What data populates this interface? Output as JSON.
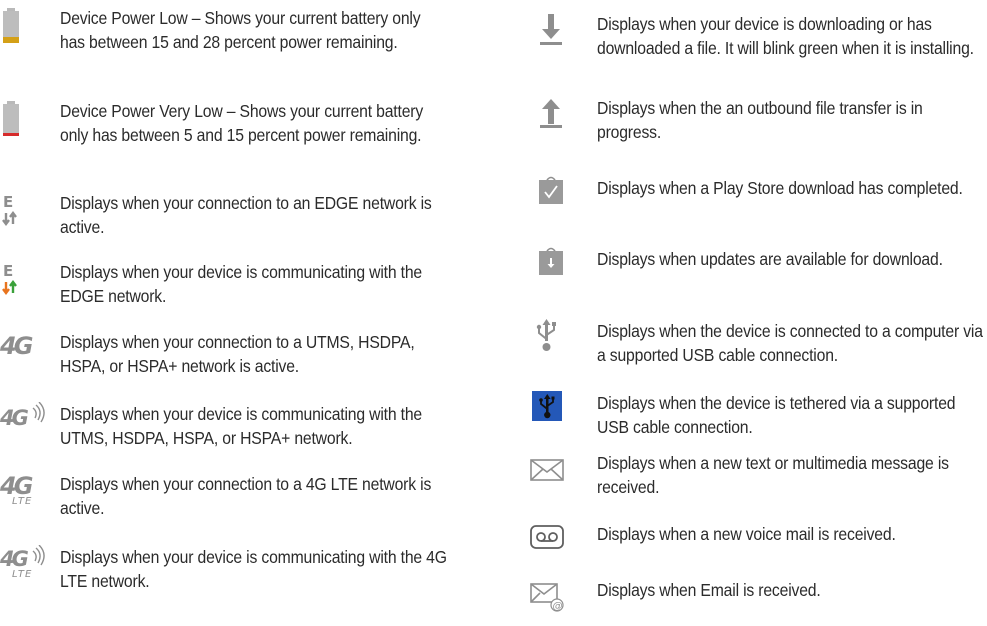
{
  "left_items": [
    {
      "icon": "battery-low-icon",
      "text": "Device Power Low – Shows your current battery only has between 15 and 28 percent power remaining."
    },
    {
      "icon": "battery-very-low-icon",
      "text": "Device Power Very Low – Shows your current battery only has between 5 and 15 percent power remaining."
    },
    {
      "icon": "edge-network-icon",
      "text": "Displays when your connection to an EDGE network is active."
    },
    {
      "icon": "edge-communicating-icon",
      "text": "Displays when your device is communicating with the EDGE network."
    },
    {
      "icon": "4g-network-icon",
      "text": "Displays when your connection to a UTMS, HSDPA, HSPA, or HSPA+ network is active."
    },
    {
      "icon": "4g-communicating-icon",
      "text": "Displays when your device is communicating with the UTMS, HSDPA, HSPA, or HSPA+ network."
    },
    {
      "icon": "4g-lte-network-icon",
      "text": "Displays when your connection to a 4G LTE network is active."
    },
    {
      "icon": "4g-lte-communicating-icon",
      "text": "Displays when your device is communicating with the 4G LTE network."
    }
  ],
  "right_items": [
    {
      "icon": "download-icon",
      "text": "Displays when your device is downloading or has downloaded a file. It will blink green when it is installing."
    },
    {
      "icon": "upload-icon",
      "text": "Displays when the an outbound file transfer is in progress."
    },
    {
      "icon": "play-store-complete-icon",
      "text": "Displays when a Play Store download has completed."
    },
    {
      "icon": "updates-available-icon",
      "text": "Displays when updates are available for download."
    },
    {
      "icon": "usb-connected-icon",
      "text": "Displays when the device is connected to a computer via a supported USB cable connection."
    },
    {
      "icon": "usb-tethered-icon",
      "text": "Displays when the device is tethered via a supported USB cable connection."
    },
    {
      "icon": "new-message-icon",
      "text": "Displays when a new text or multimedia message is received."
    },
    {
      "icon": "voicemail-icon",
      "text": "Displays when a new voice mail is received."
    },
    {
      "icon": "email-icon",
      "text": "Displays when Email is received."
    }
  ],
  "icon_labels": {
    "edge_letter": "E",
    "four_g": "4G",
    "lte": "LTE"
  },
  "colors": {
    "icon_gray": "#8e8e8e",
    "battery_low": "#d4a017",
    "battery_very_low": "#d62b2b",
    "arrow_green": "#3aa13a",
    "arrow_orange": "#e8741e",
    "usb_tether_bg": "#2458b8"
  }
}
